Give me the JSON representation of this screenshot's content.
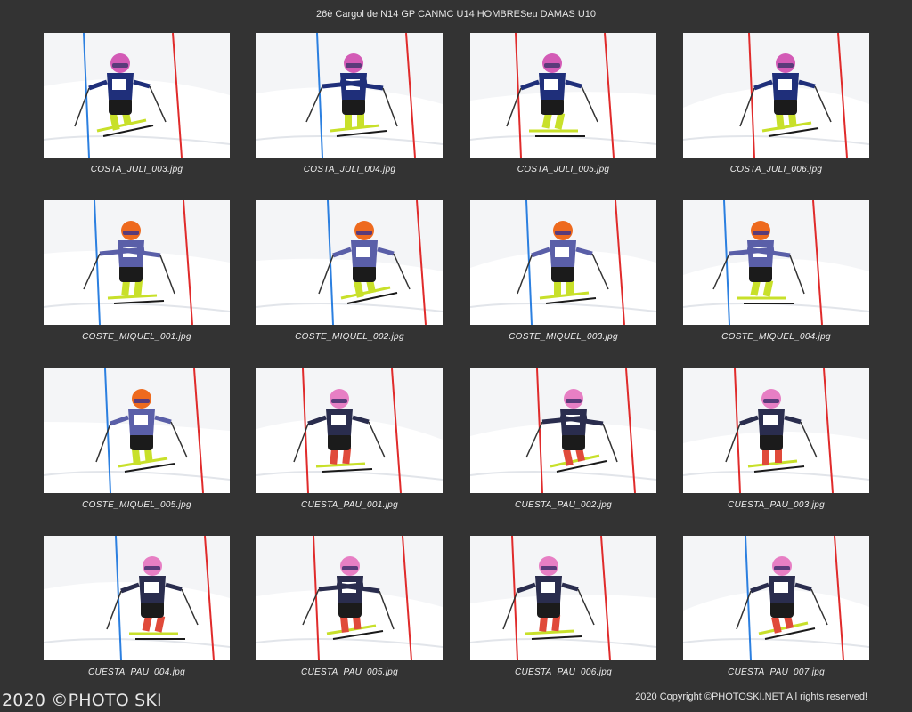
{
  "header": {
    "title": "26è Cargol de N14 GP CANMC U14 HOMBRESeu DAMAS U10"
  },
  "thumbnails": [
    {
      "filename": "COSTA_JULI_003.jpg",
      "helmet_color": "#d35bb6",
      "suit_color": "#1f2f7a",
      "boot_color": "#c8e02a",
      "gate_color": "#2b7fe0"
    },
    {
      "filename": "COSTA_JULI_004.jpg",
      "helmet_color": "#d35bb6",
      "suit_color": "#1f2f7a",
      "boot_color": "#c8e02a",
      "gate_color": "#2b7fe0"
    },
    {
      "filename": "COSTA_JULI_005.jpg",
      "helmet_color": "#d35bb6",
      "suit_color": "#1f2f7a",
      "boot_color": "#c8e02a",
      "gate_color": "#e02b2b"
    },
    {
      "filename": "COSTA_JULI_006.jpg",
      "helmet_color": "#d35bb6",
      "suit_color": "#1f2f7a",
      "boot_color": "#c8e02a",
      "gate_color": "#e02b2b"
    },
    {
      "filename": "COSTE_MIQUEL_001.jpg",
      "helmet_color": "#ee6a1e",
      "suit_color": "#5a5fa8",
      "boot_color": "#c8e02a",
      "gate_color": "#2b7fe0"
    },
    {
      "filename": "COSTE_MIQUEL_002.jpg",
      "helmet_color": "#ee6a1e",
      "suit_color": "#5a5fa8",
      "boot_color": "#c8e02a",
      "gate_color": "#2b7fe0"
    },
    {
      "filename": "COSTE_MIQUEL_003.jpg",
      "helmet_color": "#ee6a1e",
      "suit_color": "#5a5fa8",
      "boot_color": "#c8e02a",
      "gate_color": "#2b7fe0"
    },
    {
      "filename": "COSTE_MIQUEL_004.jpg",
      "helmet_color": "#ee6a1e",
      "suit_color": "#5a5fa8",
      "boot_color": "#c8e02a",
      "gate_color": "#2b7fe0"
    },
    {
      "filename": "COSTE_MIQUEL_005.jpg",
      "helmet_color": "#ee6a1e",
      "suit_color": "#5a5fa8",
      "boot_color": "#c8e02a",
      "gate_color": "#2b7fe0"
    },
    {
      "filename": "CUESTA_PAU_001.jpg",
      "helmet_color": "#e77fc4",
      "suit_color": "#2a2d4e",
      "boot_color": "#e04a3a",
      "gate_color": "#e02b2b"
    },
    {
      "filename": "CUESTA_PAU_002.jpg",
      "helmet_color": "#e77fc4",
      "suit_color": "#2a2d4e",
      "boot_color": "#e04a3a",
      "gate_color": "#e02b2b"
    },
    {
      "filename": "CUESTA_PAU_003.jpg",
      "helmet_color": "#e77fc4",
      "suit_color": "#2a2d4e",
      "boot_color": "#e04a3a",
      "gate_color": "#e02b2b"
    },
    {
      "filename": "CUESTA_PAU_004.jpg",
      "helmet_color": "#e77fc4",
      "suit_color": "#2a2d4e",
      "boot_color": "#e04a3a",
      "gate_color": "#2b7fe0"
    },
    {
      "filename": "CUESTA_PAU_005.jpg",
      "helmet_color": "#e77fc4",
      "suit_color": "#2a2d4e",
      "boot_color": "#e04a3a",
      "gate_color": "#e02b2b"
    },
    {
      "filename": "CUESTA_PAU_006.jpg",
      "helmet_color": "#e77fc4",
      "suit_color": "#2a2d4e",
      "boot_color": "#e04a3a",
      "gate_color": "#e02b2b"
    },
    {
      "filename": "CUESTA_PAU_007.jpg",
      "helmet_color": "#e77fc4",
      "suit_color": "#2a2d4e",
      "boot_color": "#e04a3a",
      "gate_color": "#2b7fe0"
    }
  ],
  "footer": {
    "watermark": "2020 ©PHOTO SKI",
    "copyright": "2020 Copyright ©PHOTOSKI.NET All rights reserved!"
  },
  "colors": {
    "background": "#333333",
    "snow": "#f4f5f7",
    "text": "#f0f0f0"
  }
}
